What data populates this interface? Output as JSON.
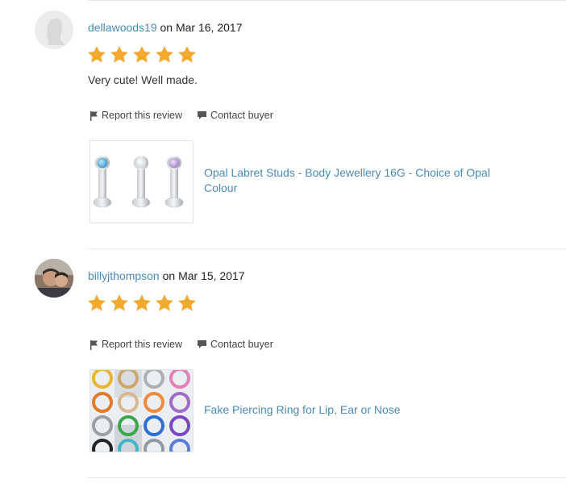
{
  "reviews": [
    {
      "username": "dellawoods19",
      "on_word": "on",
      "date": "Mar 16, 2017",
      "rating": 5,
      "rating_max": 5,
      "text": "Very cute! Well made.",
      "report_label": "Report this review",
      "contact_label": "Contact buyer",
      "item_title": "Opal Labret Studs - Body Jewellery 16G - Choice of Opal Colour",
      "avatar": "default-silhouette",
      "thumbnail": "opal-labret-studs"
    },
    {
      "username": "billyjthompson",
      "on_word": "on",
      "date": "Mar 15, 2017",
      "rating": 5,
      "rating_max": 5,
      "text": "",
      "report_label": "Report this review",
      "contact_label": "Contact buyer",
      "item_title": "Fake Piercing Ring for Lip, Ear or Nose",
      "avatar": "user-photo",
      "thumbnail": "colored-hoop-rings"
    }
  ],
  "colors": {
    "link": "#4a8bb5",
    "star": "#f1a92f",
    "text": "#222222",
    "divider": "#e6e6e6"
  },
  "icons": [
    "flag-icon",
    "chat-bubble-icon",
    "star-icon"
  ]
}
